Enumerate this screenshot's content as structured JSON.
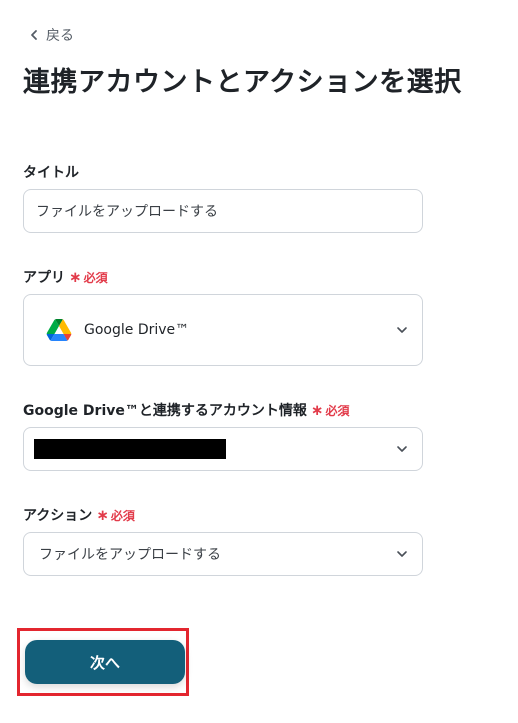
{
  "nav": {
    "back_label": "戻る"
  },
  "page_title": "連携アカウントとアクションを選択",
  "fields": {
    "title": {
      "label": "タイトル",
      "value": "ファイルをアップロードする"
    },
    "app": {
      "label": "アプリ",
      "required_label": "必須",
      "value": "Google Drive™",
      "icon": "google-drive-icon"
    },
    "account": {
      "label": "Google Drive™と連携するアカウント情報",
      "required_label": "必須"
    },
    "action": {
      "label": "アクション",
      "required_label": "必須",
      "value": "ファイルをアップロードする"
    }
  },
  "next_button": {
    "label": "次へ"
  },
  "colors": {
    "primary": "#135f7a",
    "required": "#e23b4a",
    "highlight_border": "#e3262f"
  }
}
